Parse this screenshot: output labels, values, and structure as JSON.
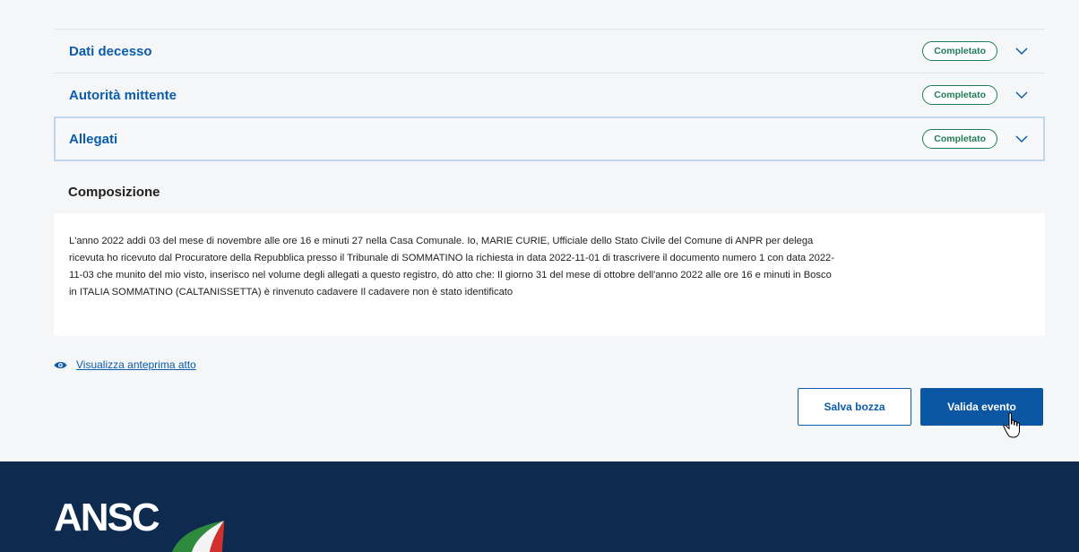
{
  "accordion": [
    {
      "title": "Dati decesso",
      "status": "Completato",
      "active": false
    },
    {
      "title": "Autorità mittente",
      "status": "Completato",
      "active": false
    },
    {
      "title": "Allegati",
      "status": "Completato",
      "active": true
    }
  ],
  "composition": {
    "title": "Composizione",
    "text": "L'anno 2022 addì 03 del mese di novembre alle ore 16 e minuti 27 nella Casa Comunale. Io, MARIE CURIE, Ufficiale dello Stato Civile del Comune di ANPR per delega ricevuta ho ricevuto dal Procuratore della Repubblica presso il Tribunale di SOMMATINO la richiesta in data 2022-11-01 di trascrivere il documento numero 1 con data 2022-11-03 che munito del mio visto, inserisco nel volume degli allegati a questo registro, dò atto che: Il giorno 31 del mese di ottobre dell'anno 2022 alle ore 16 e minuti in Bosco in ITALIA SOMMATINO (CALTANISSETTA) è rinvenuto cadavere Il cadavere non è stato identificato"
  },
  "preview_link": "Visualizza anteprima atto",
  "buttons": {
    "save_draft": "Salva bozza",
    "validate": "Valida evento"
  },
  "footer": {
    "logo_text": "ANSC"
  },
  "colors": {
    "primary": "#0b57a3",
    "link": "#0b5cab",
    "success": "#1e7b56",
    "footer_bg": "#0e2a4f"
  },
  "icons": {
    "chevron": "chevron-down-icon",
    "eye": "eye-icon",
    "cursor": "hand-pointer-icon"
  }
}
